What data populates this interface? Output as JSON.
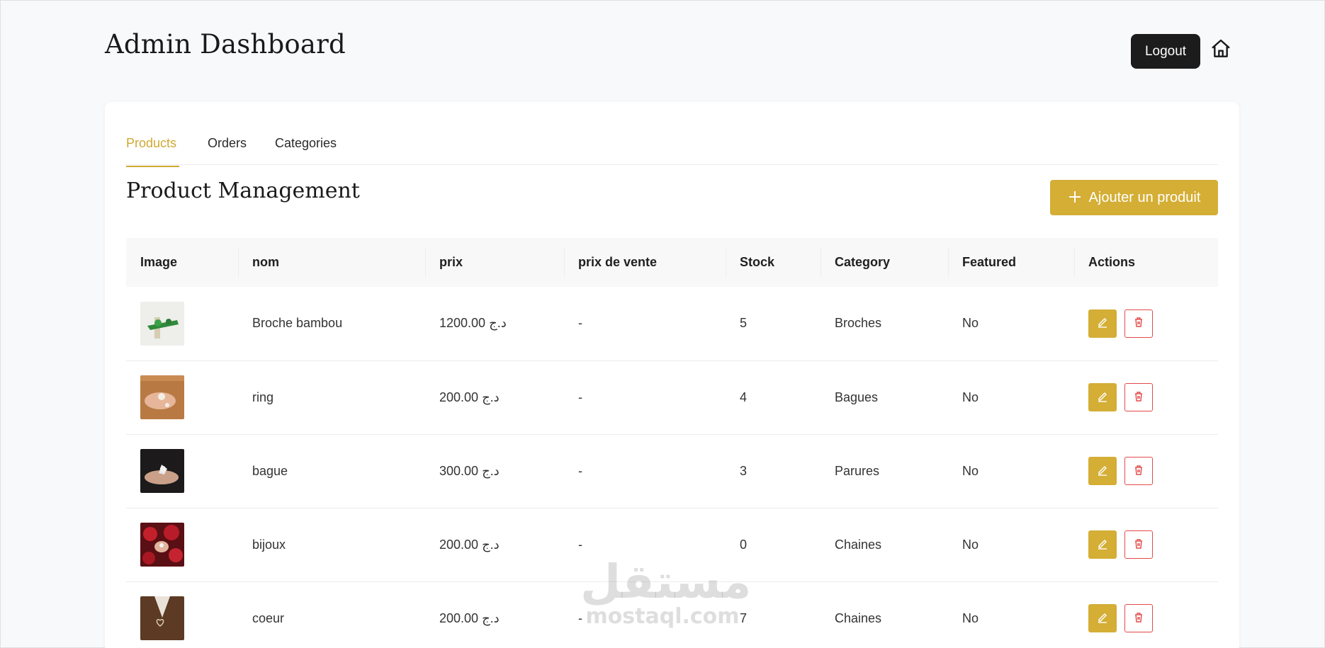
{
  "header": {
    "title": "Admin Dashboard",
    "logout_label": "Logout",
    "home_icon": "home-icon"
  },
  "tabs": [
    {
      "label": "Products",
      "active": true
    },
    {
      "label": "Orders",
      "active": false
    },
    {
      "label": "Categories",
      "active": false
    }
  ],
  "main": {
    "section_title": "Product Management",
    "add_button_label": "Ajouter un produit",
    "add_icon": "plus-icon"
  },
  "table": {
    "columns": [
      "Image",
      "nom",
      "prix",
      "prix de vente",
      "Stock",
      "Category",
      "Featured",
      "Actions"
    ],
    "rows": [
      {
        "image": "product-thumbnail",
        "nom": "Broche bambou",
        "prix": "1200.00 د.ج",
        "prix_vente": "-",
        "stock": "5",
        "category": "Broches",
        "featured": "No"
      },
      {
        "image": "product-thumbnail",
        "nom": "ring",
        "prix": "200.00 د.ج",
        "prix_vente": "-",
        "stock": "4",
        "category": "Bagues",
        "featured": "No"
      },
      {
        "image": "product-thumbnail",
        "nom": "bague",
        "prix": "300.00 د.ج",
        "prix_vente": "-",
        "stock": "3",
        "category": "Parures",
        "featured": "No"
      },
      {
        "image": "product-thumbnail",
        "nom": "bijoux",
        "prix": "200.00 د.ج",
        "prix_vente": "-",
        "stock": "0",
        "category": "Chaines",
        "featured": "No"
      },
      {
        "image": "product-thumbnail",
        "nom": "coeur",
        "prix": "200.00 د.ج",
        "prix_vente": "-",
        "stock": "7",
        "category": "Chaines",
        "featured": "No"
      }
    ]
  },
  "watermark": {
    "arabic": "مستقل",
    "latin": "mostaql.com"
  },
  "colors": {
    "accent": "#d4ae35",
    "danger": "#e34a4a",
    "dark_button": "#1c1c1c"
  }
}
